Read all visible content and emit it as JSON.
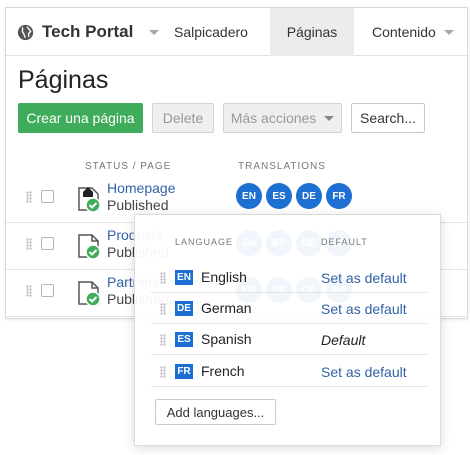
{
  "brand": {
    "title": "Tech Portal"
  },
  "nav": {
    "tabs": [
      "Salpicadero",
      "Páginas",
      "Contenido"
    ]
  },
  "page": {
    "title": "Páginas"
  },
  "toolbar": {
    "create_label": "Crear una página",
    "delete_label": "Delete",
    "more_label": "Más acciones",
    "search_label": "Search..."
  },
  "table": {
    "headers": {
      "status": "STATUS / PAGE",
      "translations": "TRANSLATIONS"
    },
    "rows": [
      {
        "title": "Homepage",
        "status": "Published",
        "langs": [
          "EN",
          "ES",
          "DE",
          "FR"
        ]
      },
      {
        "title": "Products",
        "status": "Published",
        "langs": [
          "EN",
          "ES",
          "DE",
          "FR"
        ]
      },
      {
        "title": "Partners",
        "status": "Published",
        "langs": [
          "EN",
          "ES",
          "DE",
          "FR"
        ]
      }
    ]
  },
  "language_menu": {
    "headers": {
      "language": "LANGUAGE",
      "default": "DEFAULT"
    },
    "languages": [
      {
        "code": "EN",
        "name": "English",
        "action": "Set as default"
      },
      {
        "code": "DE",
        "name": "German",
        "action": "Set as default"
      },
      {
        "code": "ES",
        "name": "Spanish",
        "action": "Default"
      },
      {
        "code": "FR",
        "name": "French",
        "action": "Set as default"
      }
    ],
    "add_label": "Add languages..."
  },
  "colors": {
    "accent": "#1d6fd1",
    "create": "#3fac5b",
    "link": "#3262a7"
  }
}
